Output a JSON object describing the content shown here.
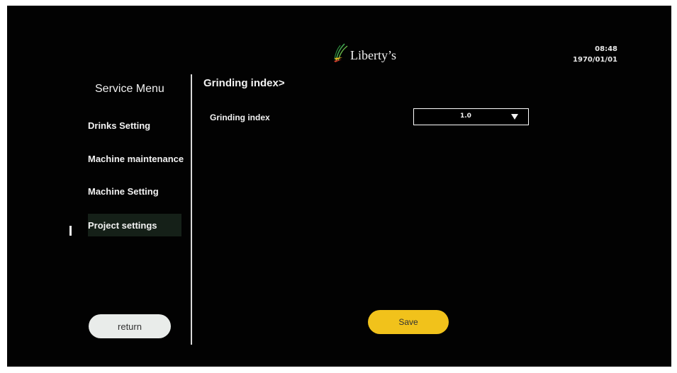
{
  "header": {
    "logo_text": "Liberty’s",
    "logo_icon": "leaf-logo-icon",
    "time": "08:48",
    "date": "1970/01/01"
  },
  "sidebar": {
    "title": "Service Menu",
    "items": [
      {
        "label": "Drinks Setting",
        "active": false
      },
      {
        "label": "Machine maintenance",
        "active": false
      },
      {
        "label": "Machine Setting",
        "active": false
      },
      {
        "label": "Project settings",
        "active": true
      }
    ],
    "return_label": "return"
  },
  "main": {
    "title": "Grinding index>",
    "field_label": "Grinding index",
    "field_value": "1.0",
    "save_label": "Save"
  },
  "colors": {
    "background": "#020202",
    "save_button": "#f1c21b",
    "return_button": "#e9ecea",
    "active_item_bg": "#152018"
  }
}
